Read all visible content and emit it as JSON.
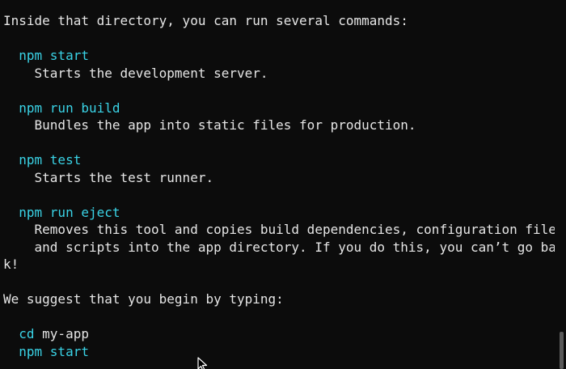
{
  "terminal": {
    "intro": "Inside that directory, you can run several commands:",
    "commands": [
      {
        "cmd": "npm start",
        "desc": [
          "Starts the development server."
        ]
      },
      {
        "cmd": "npm run build",
        "desc": [
          "Bundles the app into static files for production."
        ]
      },
      {
        "cmd": "npm test",
        "desc": [
          "Starts the test runner."
        ]
      },
      {
        "cmd": "npm run eject",
        "desc": [
          "Removes this tool and copies build dependencies, configuration files",
          "and scripts into the app directory. If you do this, you can’t go bac"
        ],
        "wrap": "k!"
      }
    ],
    "suggest": "We suggest that you begin by typing:",
    "suggested": {
      "cd_keyword": "cd",
      "cd_arg": " my-app",
      "start": "npm start"
    }
  },
  "colors": {
    "background": "#0c0c0c",
    "command": "#3ad3e6",
    "text": "#e6e6e6"
  },
  "icons": {
    "cursor": "mouse-pointer-icon"
  }
}
